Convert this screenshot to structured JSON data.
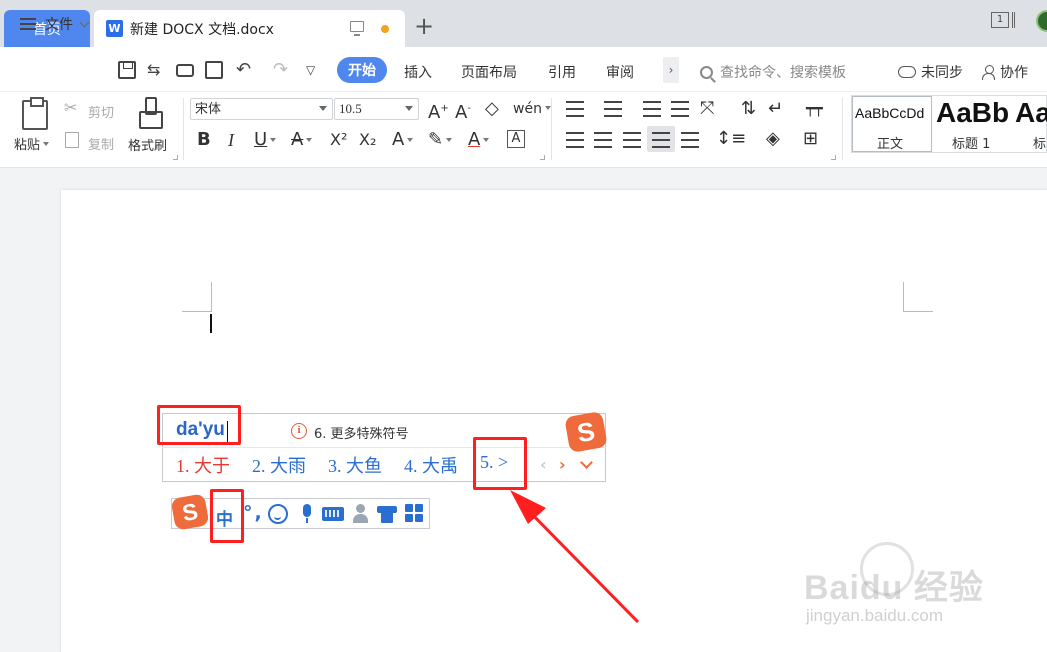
{
  "tabs": {
    "home": "首页",
    "doc_title": "新建 DOCX 文档.docx",
    "doc_icon_letter": "W",
    "window_count": "1"
  },
  "menubar": {
    "file": "文件",
    "start": "开始",
    "items": [
      "插入",
      "页面布局",
      "引用",
      "审阅"
    ],
    "more": "›",
    "search_placeholder": "查找命令、搜索模板",
    "sync": "未同步",
    "collab": "协作"
  },
  "ribbon": {
    "paste": "粘贴",
    "cut": "剪切",
    "copy": "复制",
    "format_painter": "格式刷",
    "font_name": "宋体",
    "font_size": "10.5",
    "bold": "B",
    "italic": "I",
    "underline": "U",
    "superscript": "X²",
    "subscript": "X₂",
    "pinyin": "wén",
    "styles": [
      {
        "sample": "AaBbCcDd",
        "name": "正文"
      },
      {
        "sample": "AaBb",
        "name": "标题 1"
      },
      {
        "sample": "Aa",
        "name": "标"
      }
    ]
  },
  "ime": {
    "pinyin": "da'yu",
    "tip_number": "6.",
    "tip_text": "更多特殊符号",
    "candidates": [
      "1. 大于",
      "2. 大雨",
      "3. 大鱼",
      "4. 大禹",
      "5. >"
    ],
    "nav_prev": "‹",
    "nav_next": "›",
    "logo_letter": "S",
    "mode": "中",
    "punct": "°,"
  },
  "watermark": {
    "brand": "Baidu 经验",
    "url": "jingyan.baidu.com"
  },
  "colors": {
    "accent_blue": "#4f87ee",
    "ime_blue": "#2a6fd0",
    "ime_first_candidate": "#e53935",
    "sogou_orange": "#f06b3c",
    "annotation_red": "#ff1f1f"
  }
}
